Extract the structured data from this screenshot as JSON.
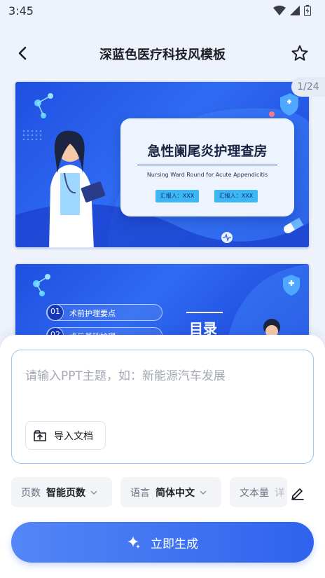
{
  "status_bar": {
    "time": "3:45",
    "icons": [
      "wifi-icon",
      "signal-icon",
      "battery-icon"
    ]
  },
  "header": {
    "title": "深蓝色医疗科技风模板",
    "back_icon": "back-arrow-icon",
    "favorite_icon": "star-icon"
  },
  "preview": {
    "page_indicator": "1/24",
    "slide1": {
      "title": "急性阑尾炎护理查房",
      "subtitle": "Nursing Ward Round for Acute Appendicitis",
      "reporter_1": "汇报人：XXX",
      "reporter_2": "汇报人：XXX"
    },
    "slide2": {
      "heading": "目录",
      "items": [
        {
          "num": "01",
          "text": "术前护理要点"
        },
        {
          "num": "02",
          "text": "术后基础护理"
        }
      ]
    }
  },
  "form": {
    "input_placeholder": "请输入PPT主题，如：新能源汽车发展",
    "import_label": "导入文档",
    "options": {
      "pages_key": "页数",
      "pages_value": "智能页数",
      "language_key": "语言",
      "language_value": "简体中文",
      "text_key": "文本量",
      "text_value": "详"
    },
    "generate_label": "立即生成"
  },
  "colors": {
    "accent": "#2f62ee",
    "slide_blue": "#1f4fe0",
    "input_border": "#9dc4f2"
  }
}
